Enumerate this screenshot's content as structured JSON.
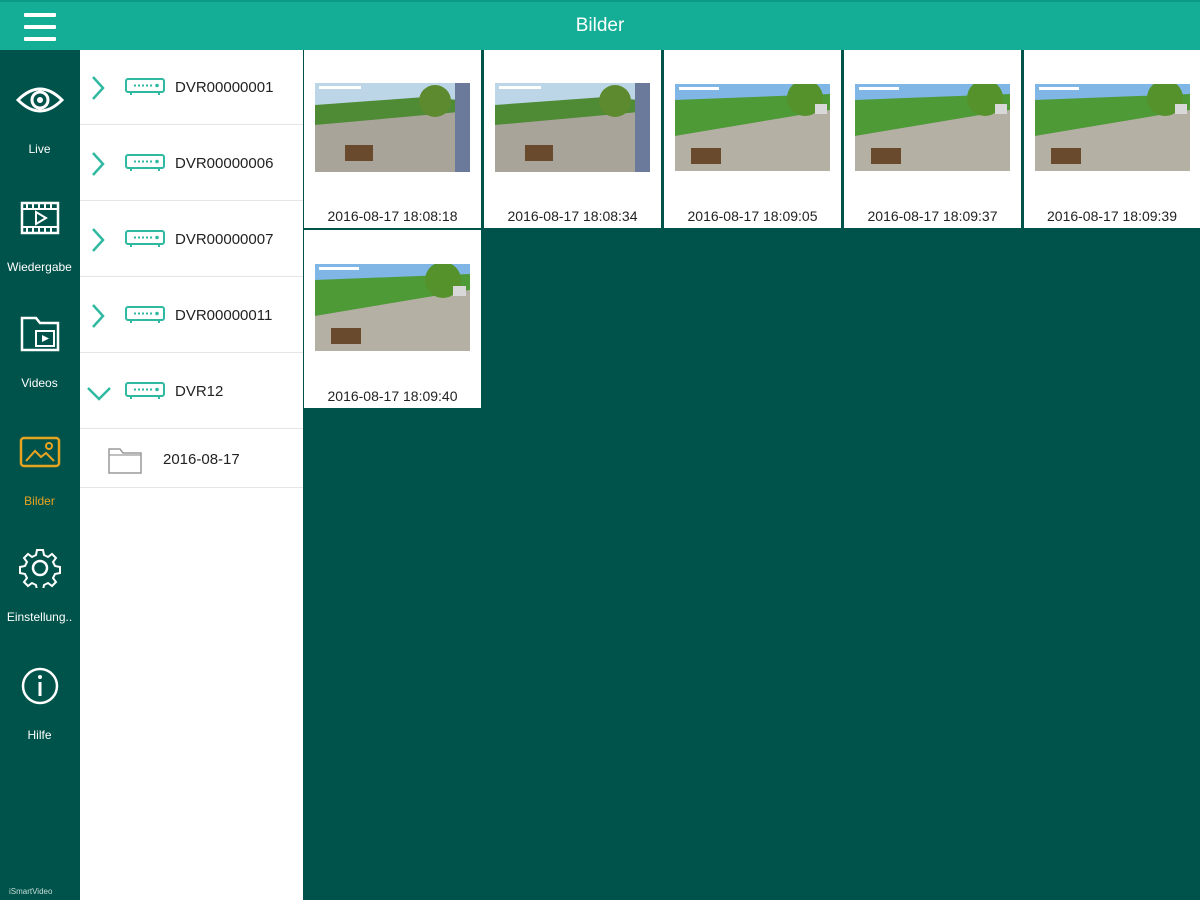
{
  "header": {
    "title": "Bilder",
    "menu_icon": "hamburger-icon"
  },
  "colors": {
    "header": "#14ad96",
    "sidebar": "#00534a",
    "accent": "#e8a321",
    "content_bg": "#00534a",
    "tree_icon": "#2fb9a1"
  },
  "sidebar": {
    "items": [
      {
        "label": "Live",
        "icon": "eye-icon",
        "active": false
      },
      {
        "label": "Wiedergabe",
        "icon": "film-icon",
        "active": false
      },
      {
        "label": "Videos",
        "icon": "video-folder-icon",
        "active": false
      },
      {
        "label": "Bilder",
        "icon": "image-icon",
        "active": true
      },
      {
        "label": "Einstellung..",
        "icon": "gear-icon",
        "active": false
      },
      {
        "label": "Hilfe",
        "icon": "info-icon",
        "active": false
      }
    ],
    "brand": "iSmartVideo"
  },
  "tree": {
    "devices": [
      {
        "name": "DVR00000001",
        "expanded": false
      },
      {
        "name": "DVR00000006",
        "expanded": false
      },
      {
        "name": "DVR00000007",
        "expanded": false
      },
      {
        "name": "DVR00000011",
        "expanded": false
      },
      {
        "name": "DVR12",
        "expanded": true
      }
    ],
    "folder": {
      "name": "2016-08-17",
      "icon": "folder-icon"
    }
  },
  "snapshots": [
    {
      "timestamp": "2016-08-17  18:08:18"
    },
    {
      "timestamp": "2016-08-17  18:08:34"
    },
    {
      "timestamp": "2016-08-17  18:09:05"
    },
    {
      "timestamp": "2016-08-17  18:09:37"
    },
    {
      "timestamp": "2016-08-17  18:09:39"
    },
    {
      "timestamp": "2016-08-17  18:09:40"
    }
  ]
}
